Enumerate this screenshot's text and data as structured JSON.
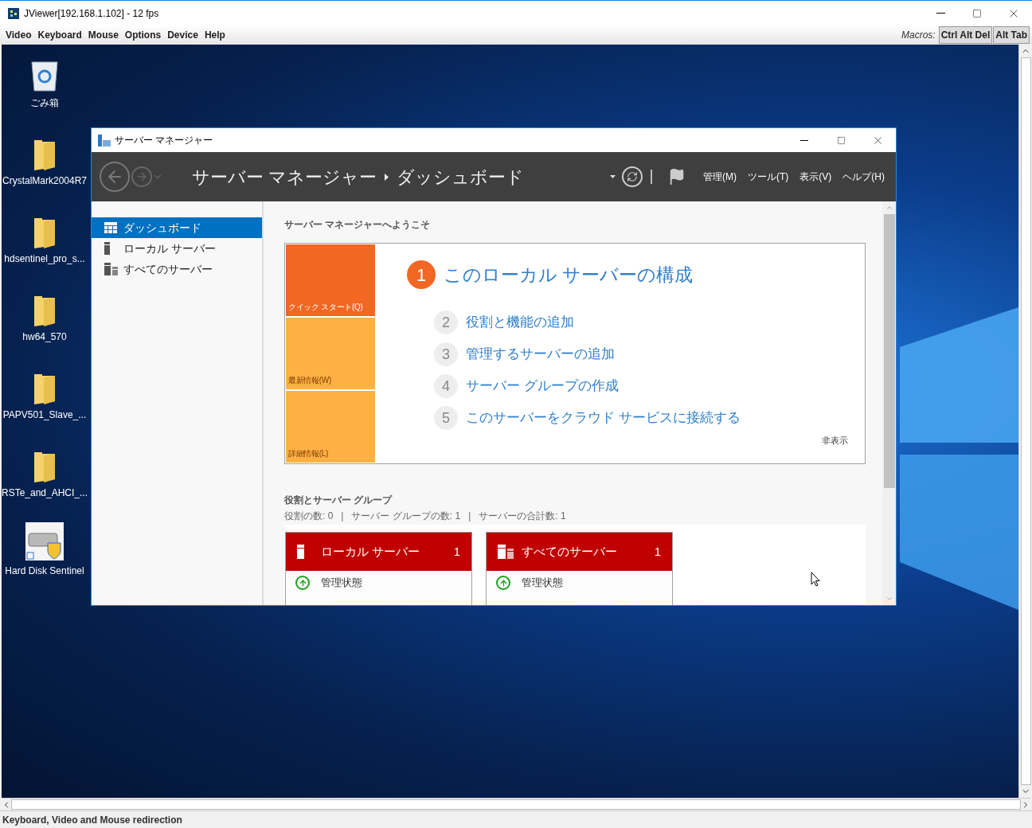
{
  "viewer": {
    "title": "JViewer[192.168.1.102] - 12 fps",
    "menu": [
      "Video",
      "Keyboard",
      "Mouse",
      "Options",
      "Device",
      "Help"
    ],
    "macros_label": "Macros:",
    "macro_buttons": [
      "Ctrl Alt Del",
      "Alt Tab"
    ],
    "status_bar": "Keyboard, Video and Mouse redirection"
  },
  "desktop_icons": [
    {
      "label": "ごみ箱",
      "kind": "recycle_bin"
    },
    {
      "label": "CrystalMark2004R7",
      "kind": "folder"
    },
    {
      "label": "hdsentinel_pro_s...",
      "kind": "folder"
    },
    {
      "label": "hw64_570",
      "kind": "folder"
    },
    {
      "label": "PAPV501_Slave_...",
      "kind": "folder"
    },
    {
      "label": "RSTe_and_AHCI_...",
      "kind": "folder"
    },
    {
      "label": "Hard Disk Sentinel",
      "kind": "app"
    }
  ],
  "server_manager": {
    "title": "サーバー マネージャー",
    "breadcrumb": [
      "サーバー マネージャー",
      "ダッシュボード"
    ],
    "menu": [
      "管理(M)",
      "ツール(T)",
      "表示(V)",
      "ヘルプ(H)"
    ],
    "nav": [
      {
        "label": "ダッシュボード",
        "kind": "dashboard",
        "selected": true
      },
      {
        "label": "ローカル サーバー",
        "kind": "local",
        "selected": false
      },
      {
        "label": "すべてのサーバー",
        "kind": "all",
        "selected": false
      }
    ],
    "welcome_heading": "サーバー マネージャーへようこそ",
    "quick_tiles": [
      {
        "label": "クイック スタート(Q)",
        "selected": true
      },
      {
        "label": "最新情報(W)",
        "selected": false
      },
      {
        "label": "詳細情報(L)",
        "selected": false
      }
    ],
    "primary_step": {
      "number": "1",
      "label": "このローカル サーバーの構成"
    },
    "steps": [
      {
        "number": "2",
        "label": "役割と機能の追加"
      },
      {
        "number": "3",
        "label": "管理するサーバーの追加"
      },
      {
        "number": "4",
        "label": "サーバー グループの作成"
      },
      {
        "number": "5",
        "label": "このサーバーをクラウド サービスに接続する"
      }
    ],
    "hide_link": "非表示",
    "roles_heading": "役割とサーバー グループ",
    "roles_summary": "役割の数: 0   |   サーバー グループの数: 1   |   サーバーの合計数: 1",
    "server_tiles": [
      {
        "title": "ローカル サーバー",
        "count": "1",
        "kind": "local",
        "rows": [
          "管理状態"
        ]
      },
      {
        "title": "すべてのサーバー",
        "count": "1",
        "kind": "all",
        "rows": [
          "管理状態"
        ]
      }
    ]
  }
}
